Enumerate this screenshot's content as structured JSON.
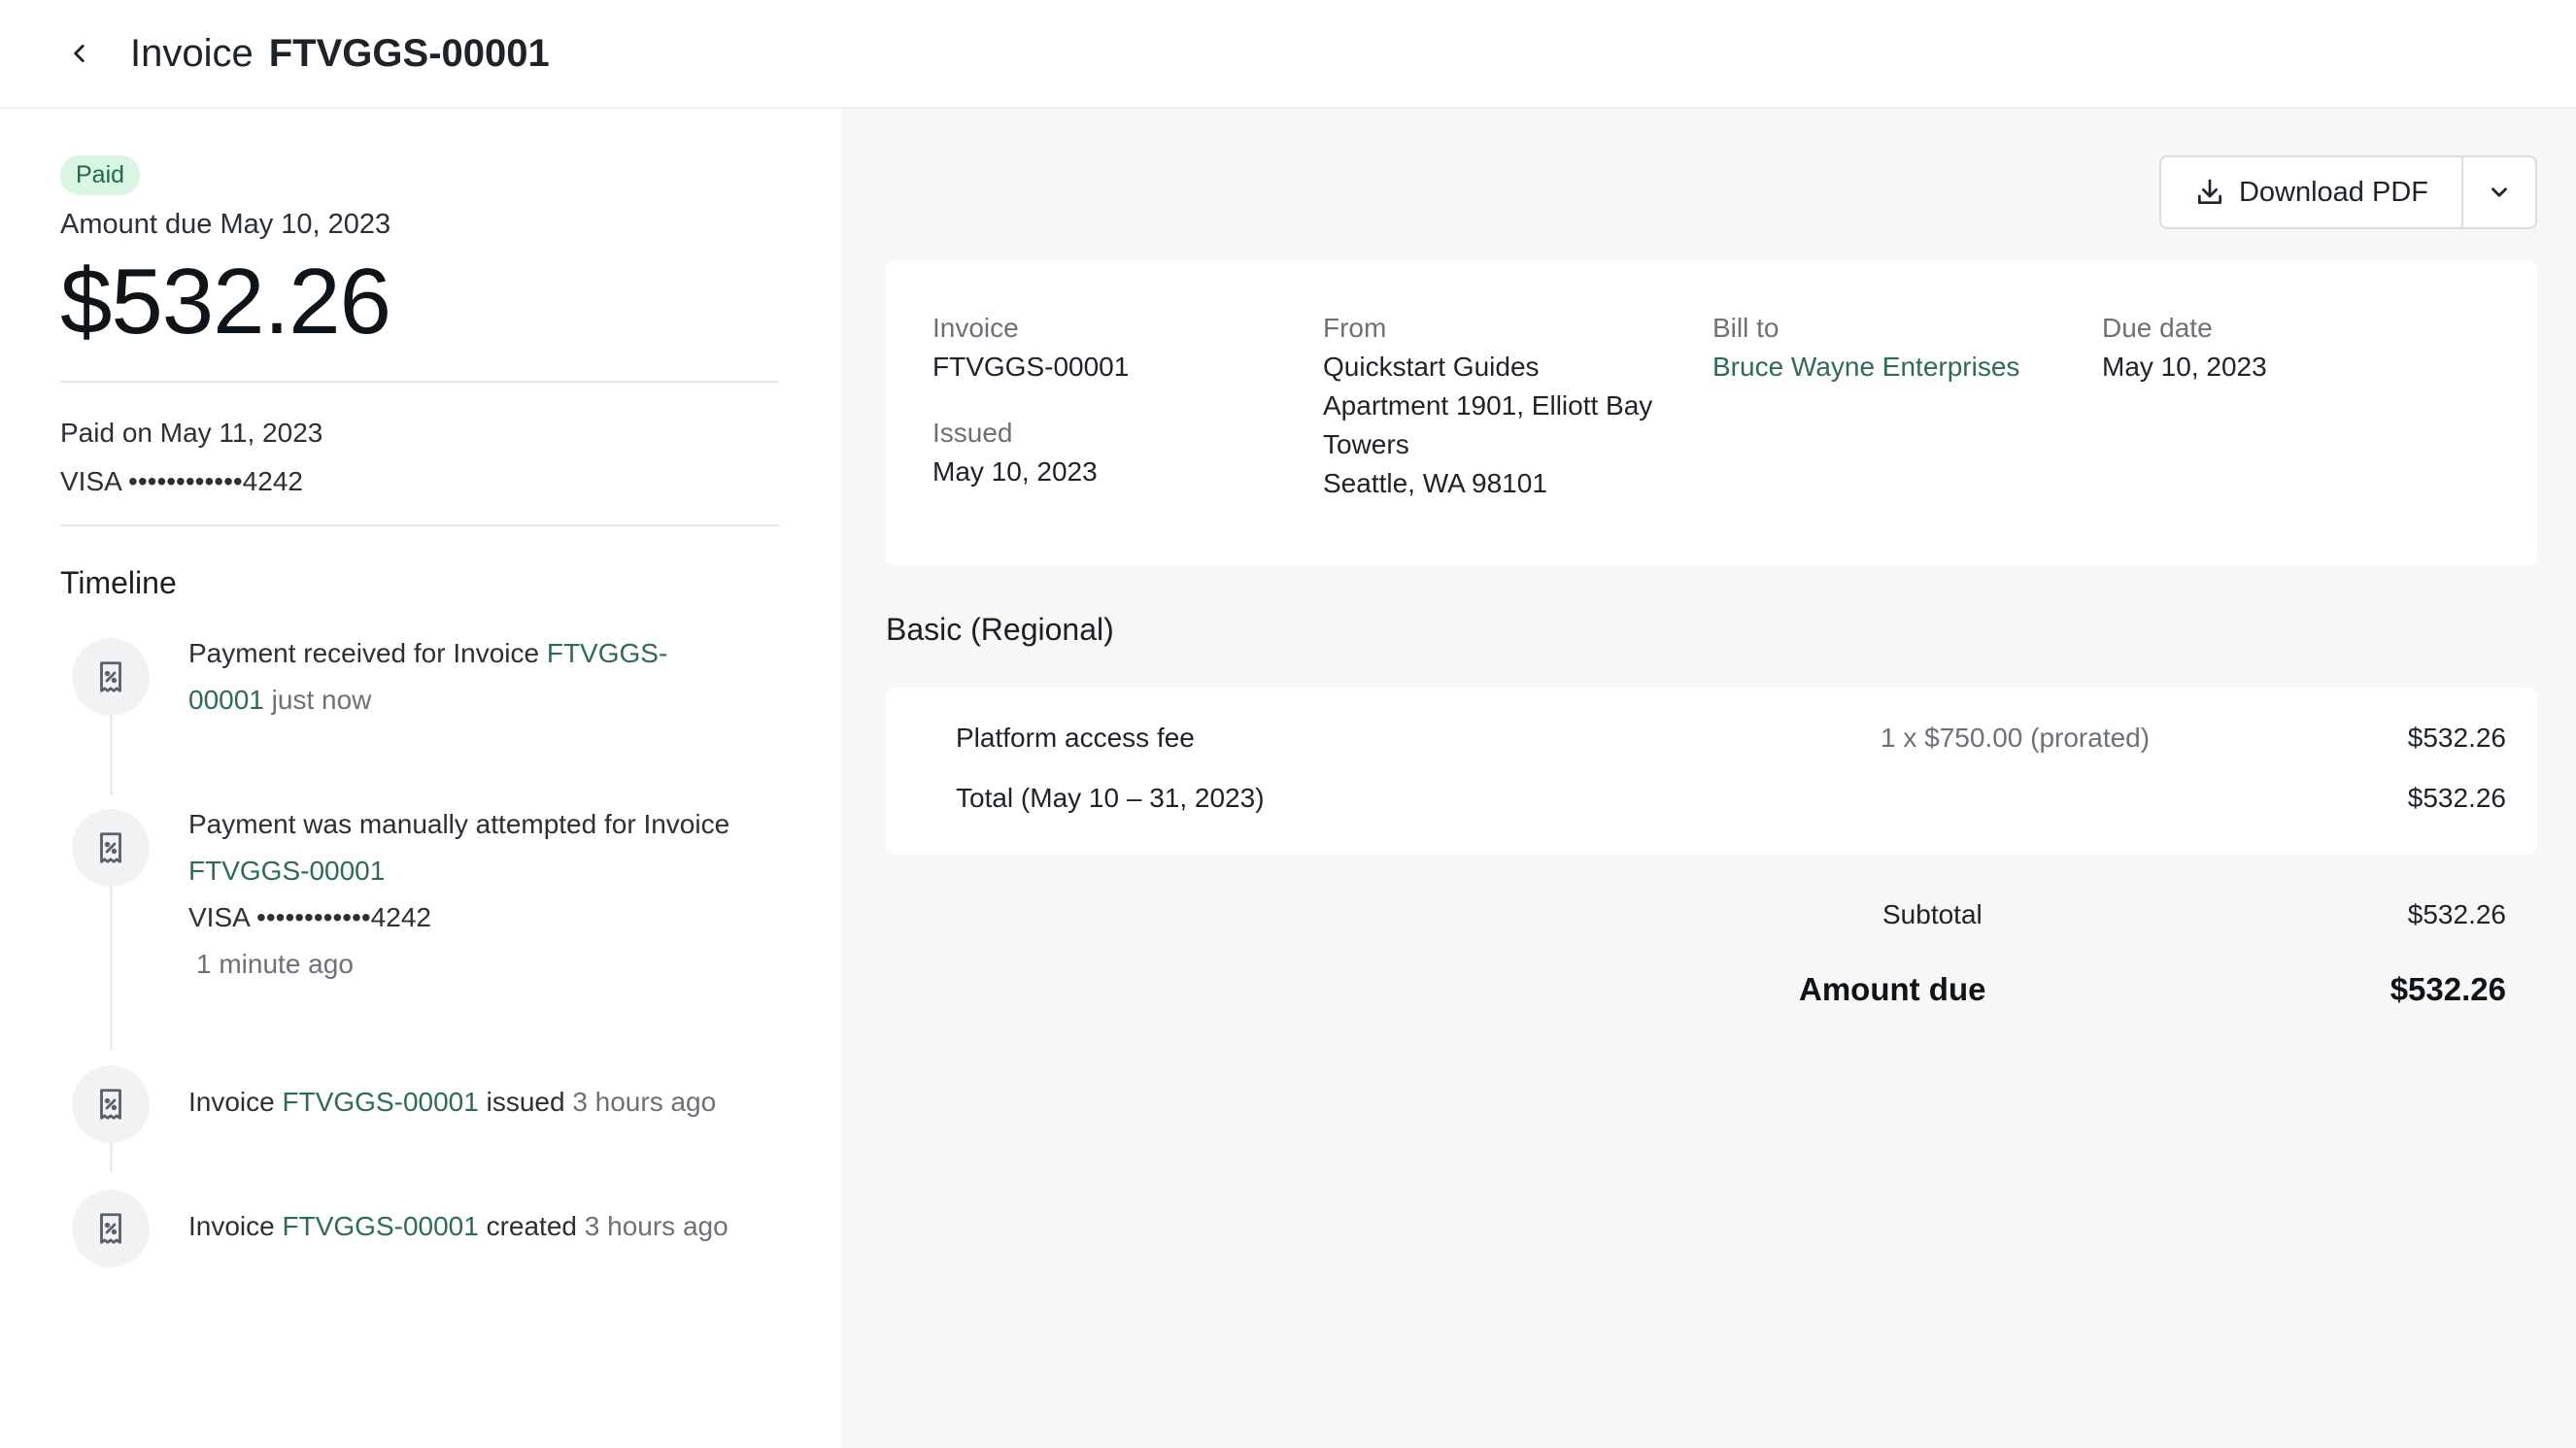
{
  "header": {
    "title_prefix": "Invoice",
    "invoice_number": "FTVGGS-00001"
  },
  "summary": {
    "status_badge": "Paid",
    "amount_due_label": "Amount due May 10, 2023",
    "amount": "$532.26",
    "paid_on": "Paid on May 11, 2023",
    "card": "VISA ••••••••••••4242"
  },
  "timeline": {
    "title": "Timeline",
    "items": [
      {
        "text_before": "Payment received for Invoice ",
        "link1": "FTVGGS-",
        "link2": "00001",
        "text_after": " ",
        "time": "just now"
      },
      {
        "text_before": "Payment was manually attempted for Invoice",
        "link": "FTVGGS-00001",
        "card": "VISA ••••••••••••4242",
        "time": "1 minute ago"
      },
      {
        "text_before": "Invoice ",
        "link": "FTVGGS-00001",
        "text_after": " issued ",
        "time": "3 hours ago"
      },
      {
        "text_before": "Invoice ",
        "link": "FTVGGS-00001",
        "text_after": " created ",
        "time": "3 hours ago"
      }
    ]
  },
  "actions": {
    "download_label": "Download PDF",
    "download_icon": "download-icon",
    "more_icon": "chevron-down-icon"
  },
  "details": {
    "invoice_label": "Invoice",
    "invoice_value": "FTVGGS-00001",
    "issued_label": "Issued",
    "issued_value": "May 10, 2023",
    "from_label": "From",
    "from_lines": [
      "Quickstart Guides",
      "Apartment 1901, Elliott Bay",
      "Towers",
      "Seattle, WA 98101"
    ],
    "bill_to_label": "Bill to",
    "bill_to_value": "Bruce Wayne Enterprises",
    "due_label": "Due date",
    "due_value": "May 10, 2023"
  },
  "plan": {
    "title": "Basic (Regional)",
    "lines": [
      {
        "desc": "Platform access fee",
        "qty": "1 x $750.00 (prorated)",
        "amount": "$532.26"
      },
      {
        "desc": "Total (May 10 – 31, 2023)",
        "qty": "",
        "amount": "$532.26"
      }
    ]
  },
  "totals": {
    "subtotal_label": "Subtotal",
    "subtotal_value": "$532.26",
    "amount_due_label": "Amount due",
    "amount_due_value": "$532.26"
  },
  "colors": {
    "accent_link": "#2d6a5a",
    "paid_badge_bg": "#d9f5e3",
    "paid_badge_text": "#1f6b3f"
  }
}
